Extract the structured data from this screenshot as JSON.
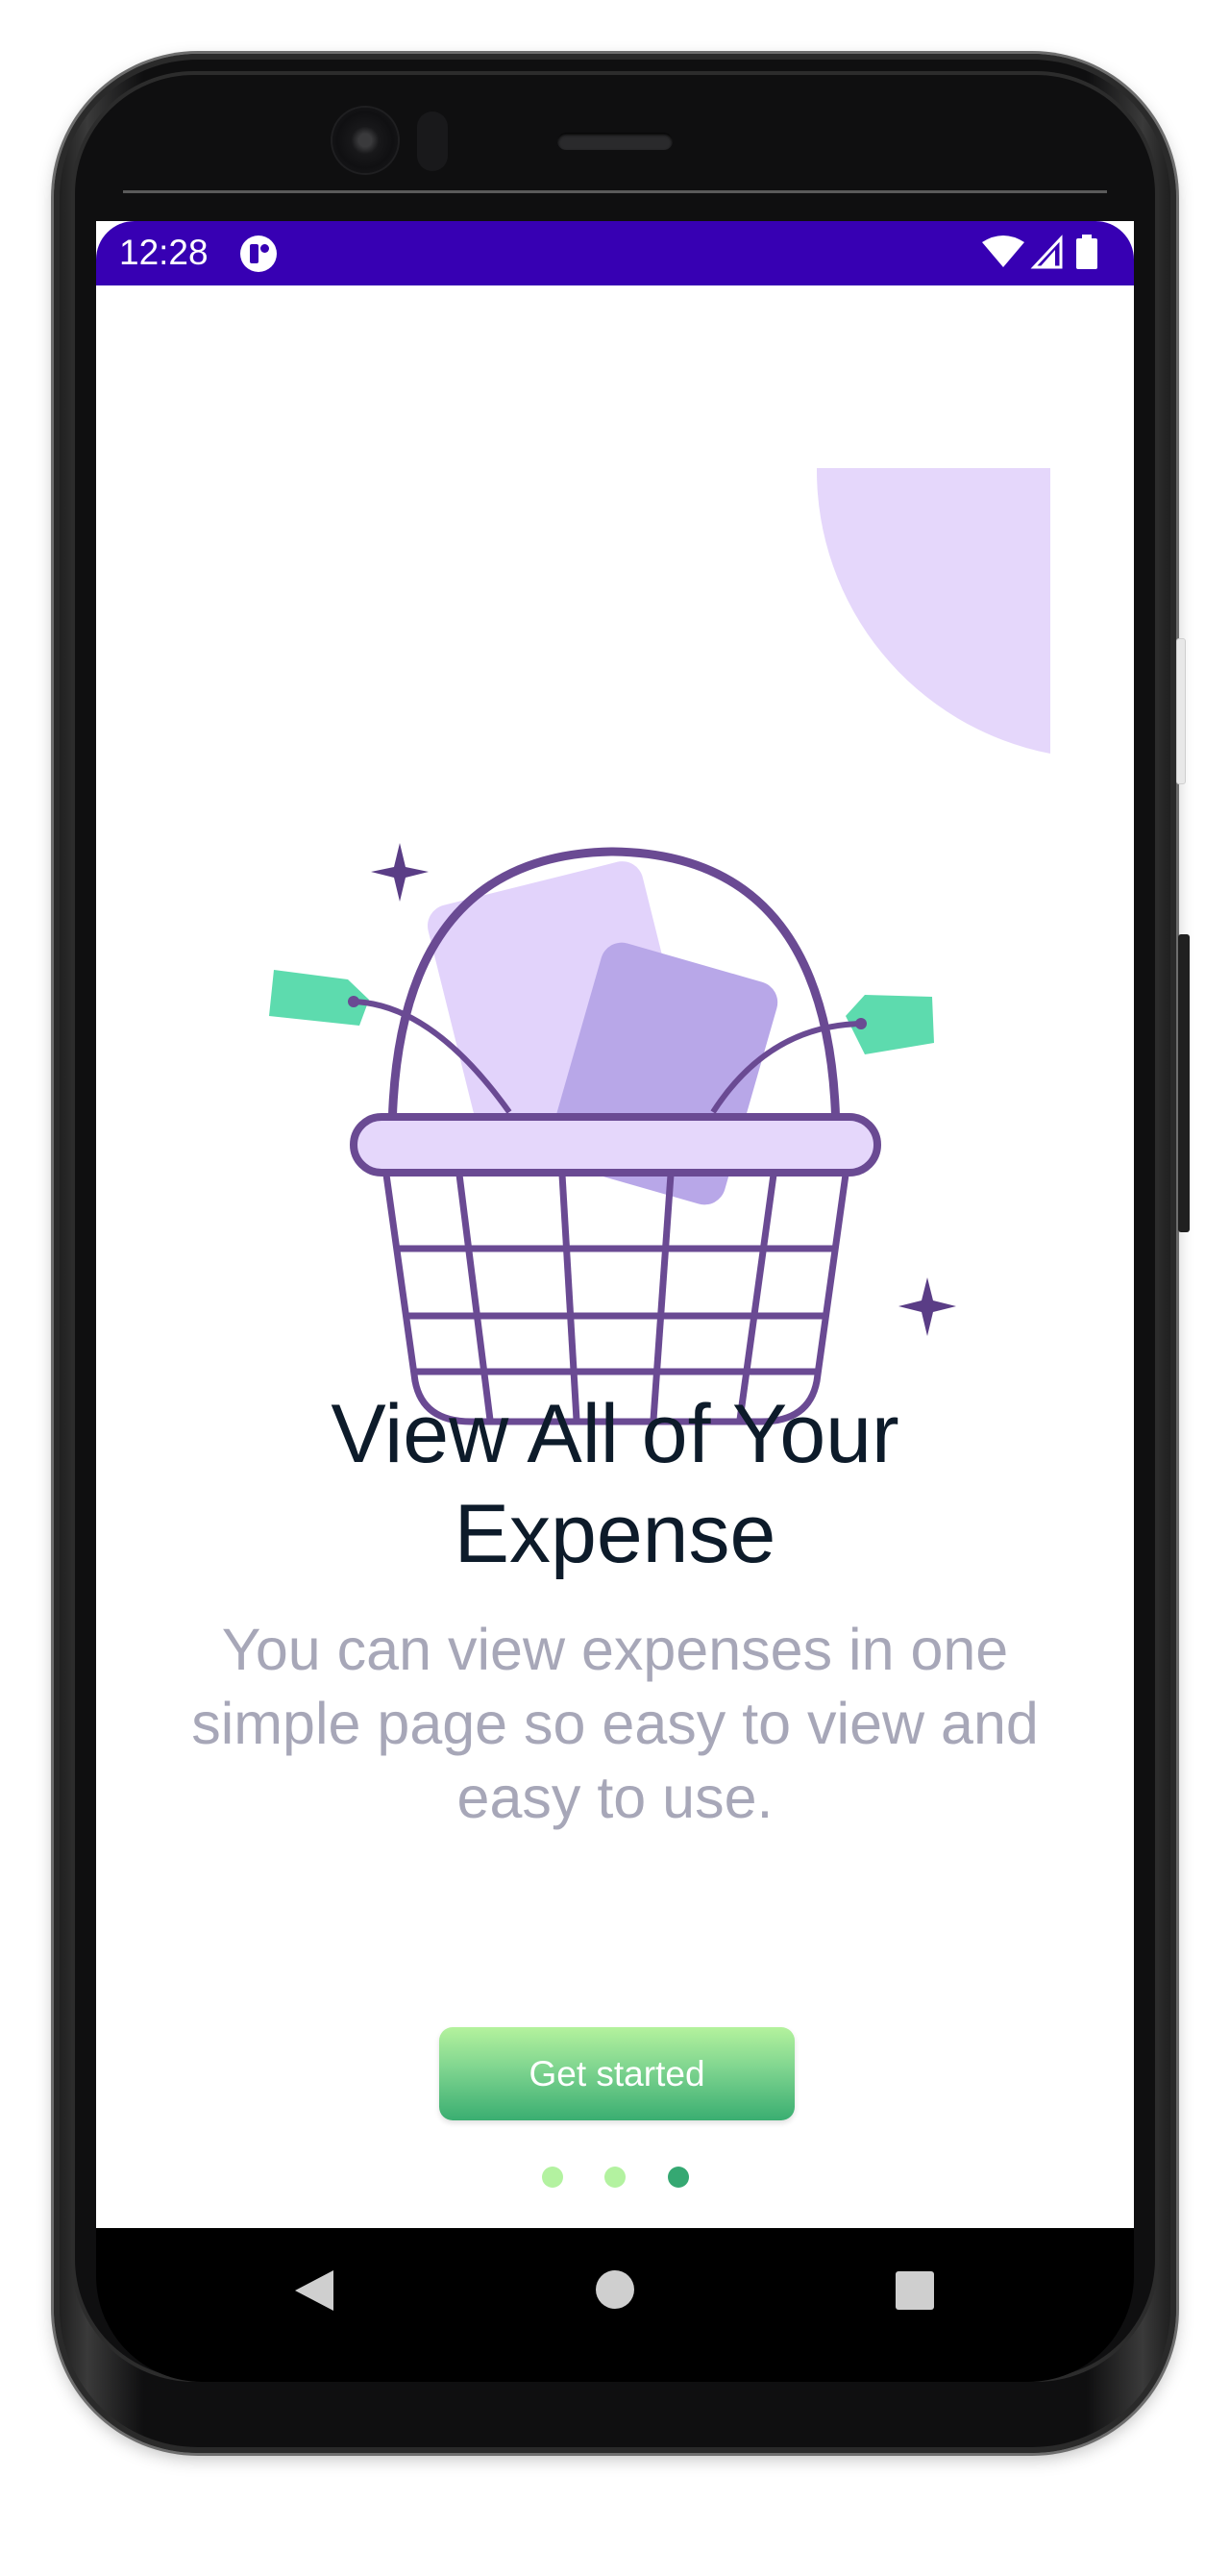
{
  "status_bar": {
    "time": "12:28",
    "background": "#3700b3",
    "icons": [
      "app-notification-icon",
      "wifi-icon",
      "signal-icon",
      "battery-icon"
    ]
  },
  "onboarding": {
    "illustration_icon": "shopping-basket-icon",
    "title": "View All of Your Expense",
    "subtitle": "You can view expenses in one simple page so easy to view and easy to use.",
    "cta_label": "Get started",
    "page_indicator": {
      "total": 3,
      "active_index": 2
    }
  },
  "colors": {
    "accent_purple": "#6a4a93",
    "basket_fill": "#e5d7fb",
    "card_fill": "#b9a8e9",
    "tag_green": "#5ddbae",
    "title": "#0d1b2a",
    "subtitle": "#a7a7b8",
    "dot_inactive": "#b3f2a0",
    "dot_active": "#35a872"
  },
  "navigation_bar": {
    "buttons": [
      "back-icon",
      "home-icon",
      "recents-icon"
    ]
  }
}
